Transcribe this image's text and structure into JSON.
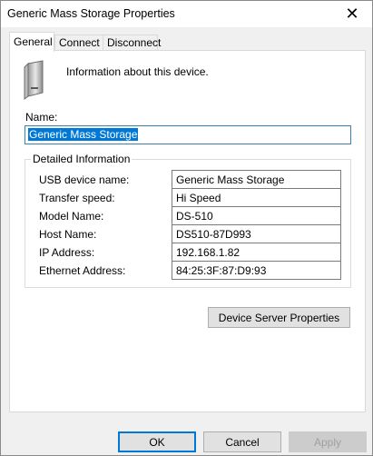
{
  "window": {
    "title": "Generic Mass Storage Properties",
    "close_glyph": "✕"
  },
  "tabs": [
    {
      "label": "General",
      "active": true
    },
    {
      "label": "Connect",
      "active": false
    },
    {
      "label": "Disconnect",
      "active": false
    }
  ],
  "general": {
    "info_text": "Information about this device.",
    "name_label": "Name:",
    "name_value": "Generic Mass Storage",
    "group_title": "Detailed Information",
    "fields": [
      {
        "label": "USB device name:",
        "value": "Generic Mass Storage"
      },
      {
        "label": "Transfer speed:",
        "value": "Hi Speed"
      },
      {
        "label": "Model Name:",
        "value": "DS-510"
      },
      {
        "label": "Host Name:",
        "value": "DS510-87D993"
      },
      {
        "label": "IP Address:",
        "value": "192.168.1.82"
      },
      {
        "label": "Ethernet Address:",
        "value": "84:25:3F:87:D9:93"
      }
    ],
    "device_server_button": "Device Server Properties"
  },
  "footer": {
    "ok": "OK",
    "cancel": "Cancel",
    "apply": "Apply"
  },
  "colors": {
    "selection": "#0078d7",
    "focus_border": "#0078d7"
  },
  "icons": {
    "device": "usb-drive-icon",
    "close": "close-icon"
  }
}
